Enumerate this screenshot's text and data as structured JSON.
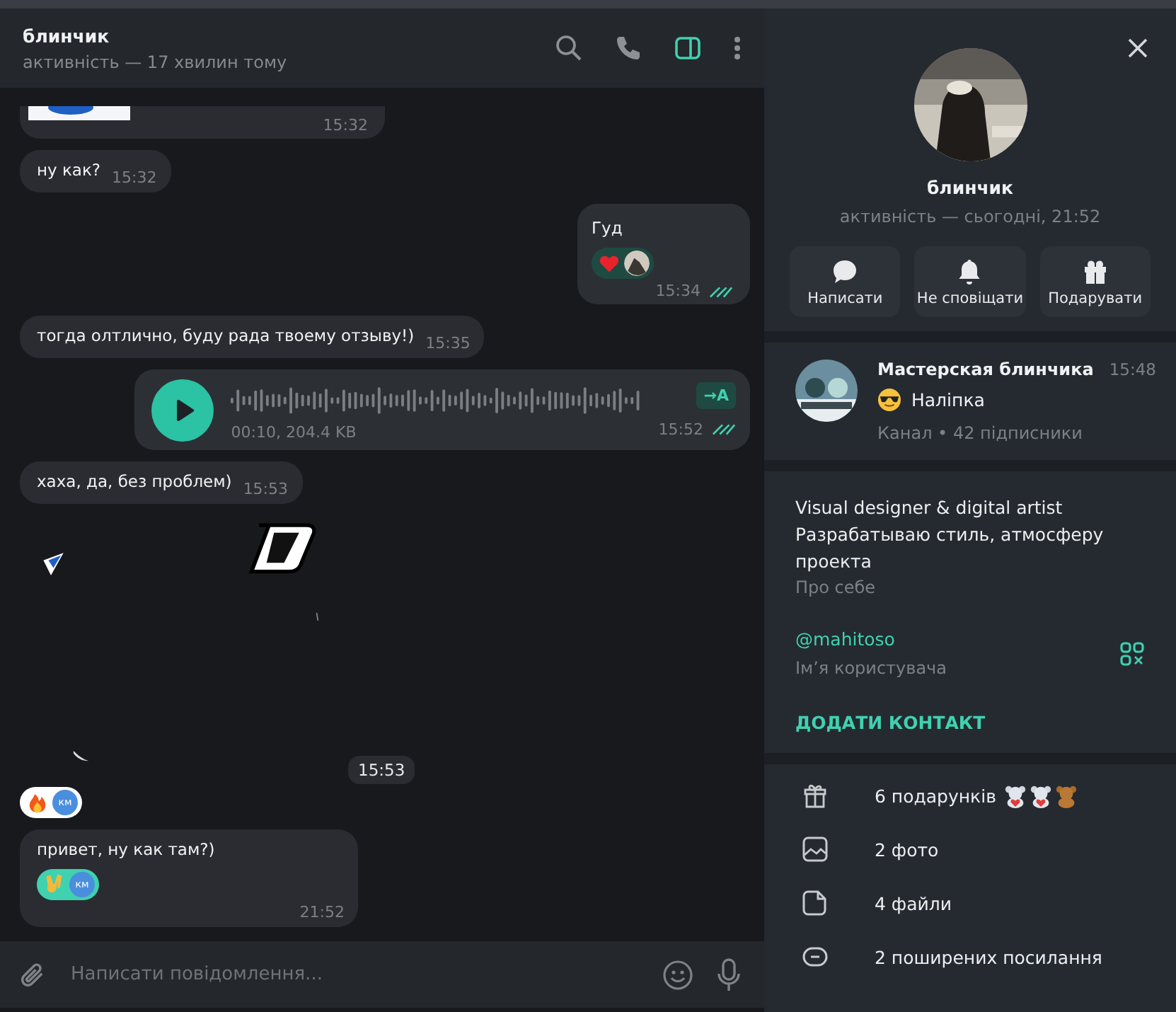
{
  "header": {
    "name": "блинчик",
    "status": "активність — 17 хвилин тому",
    "panel_open": true
  },
  "messages": [
    {
      "outgoing": false,
      "time": "15:32"
    },
    {
      "kind": "text",
      "outgoing": false,
      "text": "ну как?",
      "time": "15:32"
    },
    {
      "kind": "text",
      "outgoing": true,
      "text": "Гуд",
      "time": "15:34",
      "read": true,
      "reactions": [
        {
          "kind": "heart",
          "mine": false
        }
      ]
    },
    {
      "kind": "text",
      "outgoing": false,
      "text": "тогда олтлично, буду рада твоему отзыву!)",
      "time": "15:35"
    },
    {
      "kind": "voice",
      "outgoing": true,
      "info": "00:10, 204.4 KB",
      "transcribe": "→A",
      "time": "15:52",
      "read": true
    },
    {
      "kind": "text",
      "outgoing": false,
      "text": "хаха, да, без проблем)",
      "time": "15:53"
    },
    {
      "kind": "sticker",
      "time": "15:53",
      "reactions": [
        {
          "kind": "fire",
          "initials": "км",
          "mine": false
        }
      ]
    },
    {
      "kind": "text",
      "outgoing": false,
      "text": "привет, ну как там?)",
      "time": "21:52",
      "reactions": [
        {
          "kind": "ok",
          "initials": "км",
          "mine": true
        }
      ]
    }
  ],
  "composer": {
    "placeholder": "Написати повідомлення..."
  },
  "profile": {
    "name": "блинчик",
    "status": "активність — сьогодні, 21:52",
    "actions": [
      {
        "kind": "message",
        "label": "Написати"
      },
      {
        "kind": "mute",
        "label": "Не сповіщати"
      },
      {
        "kind": "gift",
        "label": "Подарувати"
      }
    ],
    "channel": {
      "name": "Мастерская блинчика",
      "time": "15:48",
      "preview_emoji": {
        "kind": "sunglasses"
      },
      "preview": "Наліпка",
      "meta": "Канал • 42 підписники"
    },
    "bio": "Visual designer & digital artist\nРазрабатываю стиль, атмосферу проекта",
    "bio_label": "Про себе",
    "username": "@mahitoso",
    "username_label": "Ім’я користувача",
    "add_contact": "ДОДАТИ КОНТАКТ",
    "media": [
      {
        "kind": "gifts",
        "label": "6 подарунків",
        "gifts": [
          {
            "kind": "plush"
          },
          {
            "kind": "plush"
          },
          {
            "kind": "teddy"
          }
        ]
      },
      {
        "kind": "photos",
        "label": "2 фото"
      },
      {
        "kind": "files",
        "label": "4 файли"
      },
      {
        "kind": "links",
        "label": "2 поширених посилання"
      }
    ]
  }
}
